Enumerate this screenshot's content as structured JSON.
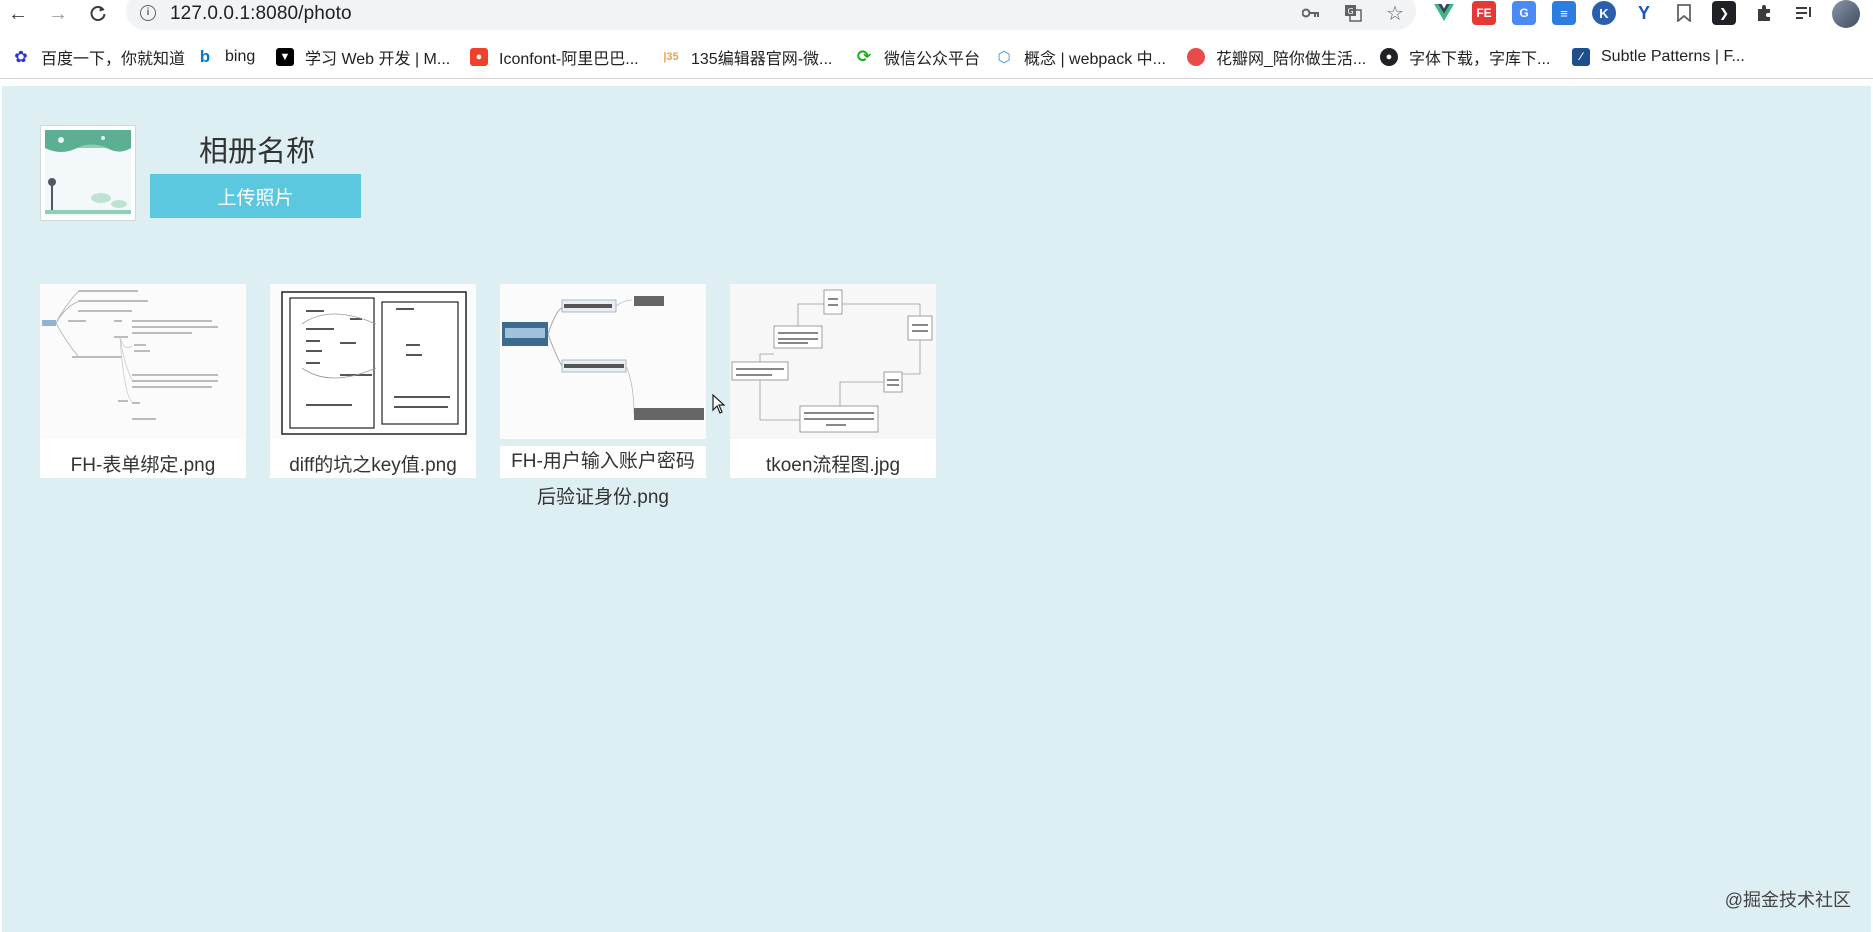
{
  "browser": {
    "url": "127.0.0.1:8080/photo",
    "nav": {
      "back_icon": "arrow-left-icon",
      "forward_icon": "arrow-right-icon",
      "reload_icon": "reload-icon"
    },
    "omnibox_icons": [
      "key-icon",
      "translate-icon",
      "star-icon"
    ],
    "extensions": [
      "vue-devtools-icon",
      "fe-helper-icon",
      "google-translate-icon",
      "todoist-icon",
      "k-extension-icon",
      "v-extension-icon",
      "bookmark-icon",
      "arrow-ext-icon",
      "puzzle-icon",
      "reading-list-icon",
      "profile-avatar"
    ]
  },
  "bookmarks": [
    {
      "label": "百度一下，你就知道",
      "icon": "baidu-paw-icon",
      "color": "#2932e1"
    },
    {
      "label": "bing",
      "icon": "bing-icon",
      "color": "#0078d7"
    },
    {
      "label": "学习 Web 开发 | M...",
      "icon": "mdn-icon",
      "color": "#000000"
    },
    {
      "label": "Iconfont-阿里巴巴...",
      "icon": "iconfont-icon",
      "color": "#f2412b"
    },
    {
      "label": "135编辑器官网-微...",
      "icon": "135-editor-icon",
      "color": "#e8a24c"
    },
    {
      "label": "微信公众平台",
      "icon": "wechat-mp-icon",
      "color": "#1aad19"
    },
    {
      "label": "概念 | webpack 中...",
      "icon": "webpack-icon",
      "color": "#8ed6fb"
    },
    {
      "label": "花瓣网_陪你做生活...",
      "icon": "huaban-icon",
      "color": "#e94b4b"
    },
    {
      "label": "字体下载，字库下...",
      "icon": "globe-icon",
      "color": "#202124"
    },
    {
      "label": "Subtle Patterns | F...",
      "icon": "subtle-patterns-icon",
      "color": "#1e4e8c"
    }
  ],
  "album": {
    "title": "相册名称",
    "upload_label": "上传照片"
  },
  "photos": [
    {
      "name": "FH-表单绑定.png"
    },
    {
      "name": "diff的坑之key值.png"
    },
    {
      "name_line1": "FH-用户输入账户密码",
      "name_line2": "后验证身份.png"
    },
    {
      "name": "tkoen流程图.jpg"
    }
  ],
  "watermark": "@掘金技术社区",
  "colors": {
    "page_bg": "#deeff4",
    "upload_button": "#5bc8df"
  }
}
